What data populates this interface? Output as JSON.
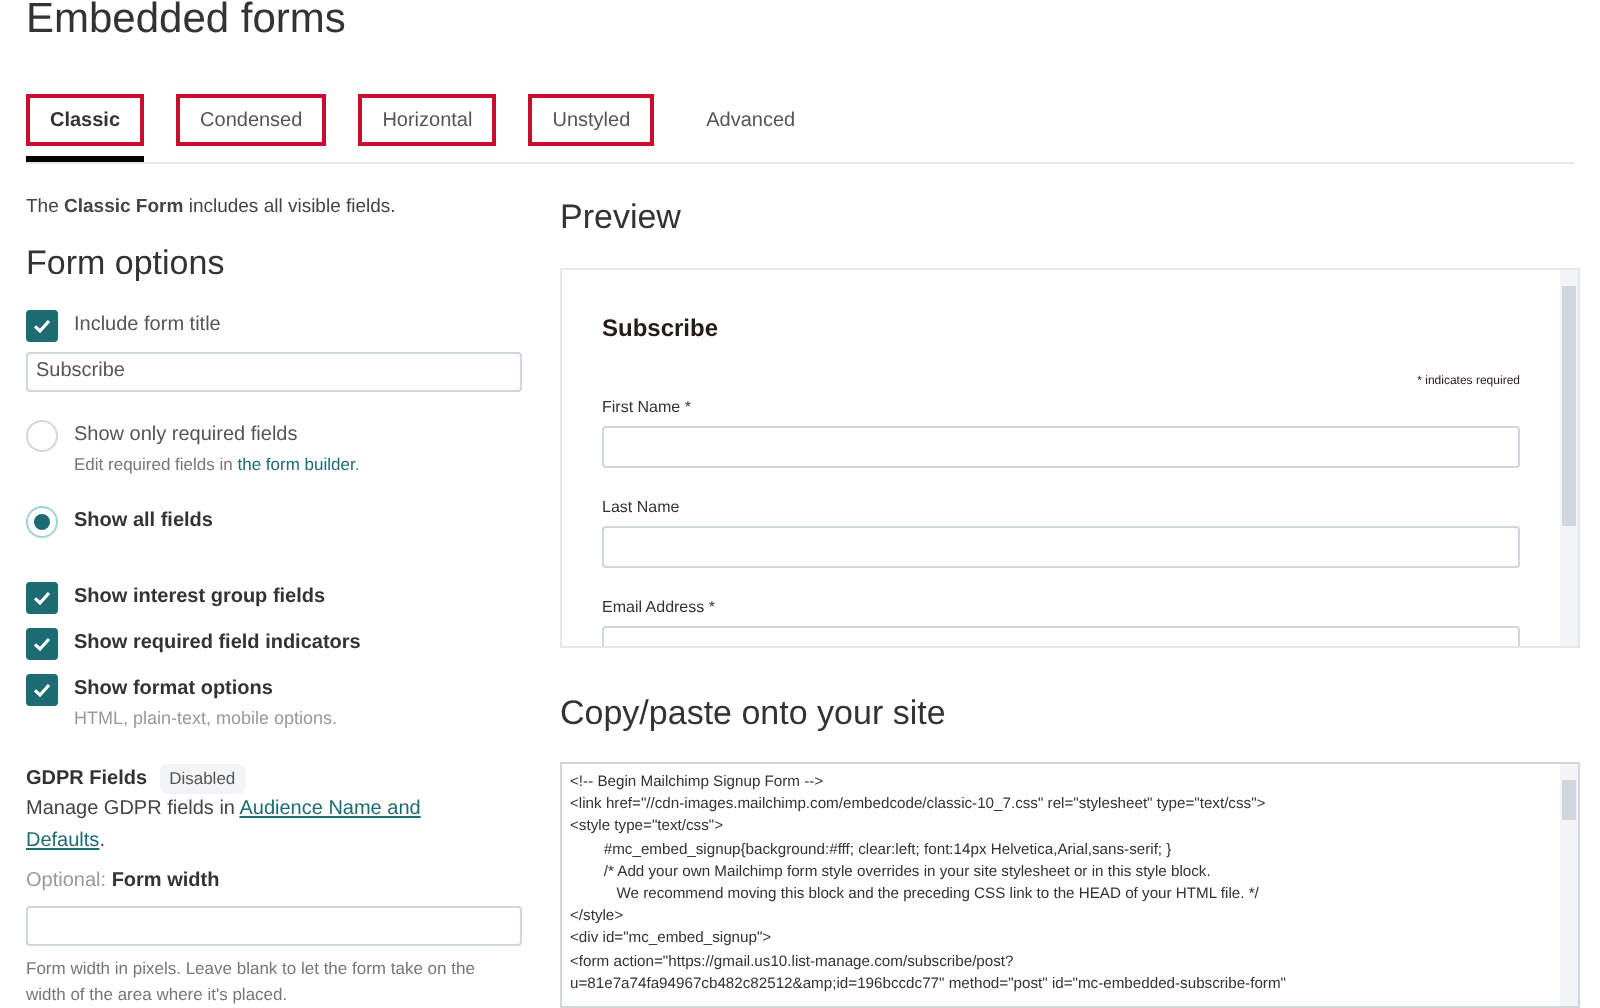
{
  "page_title": "Embedded forms",
  "tabs": [
    {
      "label": "Classic",
      "selected": true,
      "highlighted": true
    },
    {
      "label": "Condensed",
      "selected": false,
      "highlighted": true
    },
    {
      "label": "Horizontal",
      "selected": false,
      "highlighted": true
    },
    {
      "label": "Unstyled",
      "selected": false,
      "highlighted": true
    },
    {
      "label": "Advanced",
      "selected": false,
      "highlighted": false
    }
  ],
  "description": "The **Classic Form** includes all visible fields.",
  "form_options": {
    "heading": "Form options",
    "include_title": {
      "label": "Include form title",
      "checked": true
    },
    "title_value": "Subscribe",
    "field_modes": [
      {
        "label": "Show only required fields",
        "selected": false,
        "hint": "Edit required fields in ",
        "hint_link": "the form builder",
        "hint_end": "."
      },
      {
        "label": "Show all fields",
        "selected": true
      }
    ],
    "checkboxes": [
      {
        "label": "Show interest group fields",
        "checked": true
      },
      {
        "label": "Show required field indicators",
        "checked": true
      },
      {
        "label": "Show format options",
        "checked": true,
        "hint": "HTML, plain-text, mobile options."
      }
    ],
    "gdpr": {
      "label": "GDPR Fields",
      "badge": "Disabled",
      "text": "Manage GDPR fields in ",
      "link_parts": [
        "Audience Name and",
        "Defaults"
      ],
      "end": "."
    },
    "width_label_optional": "Optional:",
    "width_label": "Form width",
    "width_help": "Form width in pixels. Leave blank to let the form take on the width of the area where it's placed."
  },
  "preview": {
    "heading": "Preview",
    "form_title": "Subscribe",
    "required_note": "* indicates required",
    "fields": [
      {
        "label": "First Name",
        "marker": "*"
      },
      {
        "label": "Last Name"
      },
      {
        "label": "Email Address",
        "marker": "*"
      }
    ]
  },
  "code": {
    "heading": "Copy/paste onto your site",
    "lines": [
      "<!-- Begin Mailchimp Signup Form -->",
      "<link href=\"//cdn-images.mailchimp.com/embedcode/classic-10_7.css\" rel=\"stylesheet\" type=\"text/css\">",
      "<style type=\"text/css\">",
      "        #mc_embed_signup{background:#fff; clear:left; font:14px Helvetica,Arial,sans-serif; }",
      "        /* Add your own Mailchimp form style overrides in your site stylesheet or in this style block.",
      "           We recommend moving this block and the preceding CSS link to the HEAD of your HTML file. */",
      "</style>",
      "<div id=\"mc_embed_signup\">",
      "<form action=\"https://gmail.us10.list-manage.com/subscribe/post?",
      "u=81e7a74fa94967cb482c82512&amp;id=196bccdc77\" method=\"post\" id=\"mc-embedded-subscribe-form\""
    ]
  }
}
